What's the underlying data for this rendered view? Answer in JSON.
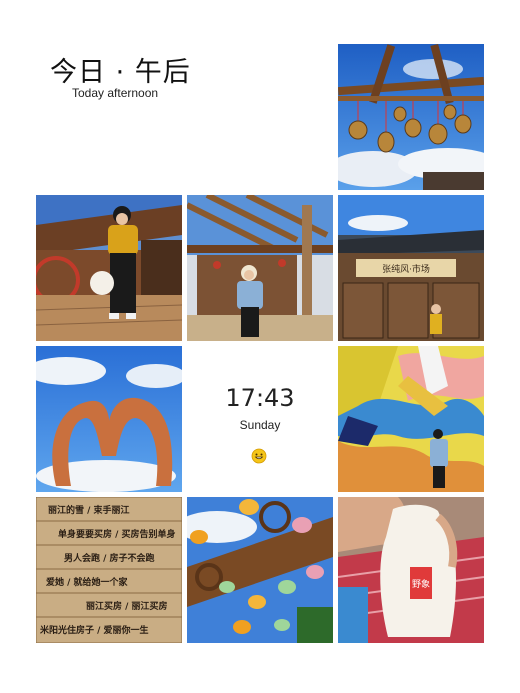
{
  "header": {
    "title_cn": "今日 · 午后",
    "subtitle": "Today afternoon"
  },
  "clock": {
    "time": "17:43",
    "day": "Sunday",
    "emoji": "grinning-face-icon"
  },
  "photos": {
    "shop_sign": "张纯风·市场",
    "bottle_brand": "野象",
    "sign_lines": [
      "丽江的雪 / 束手丽江",
      "单身要要买房 / 买房告别单身",
      "男人会跑 / 房子不会跑",
      "爱她 / 就给她一个家",
      "丽江买房 / 丽江买房",
      "米阳光住房子 / 爱丽你一生"
    ]
  },
  "colors": {
    "sky": "#2f7fe0",
    "wood": "#8a5a2e",
    "yellow_sweater": "#d9a21a",
    "denim": "#8bb0d6"
  }
}
